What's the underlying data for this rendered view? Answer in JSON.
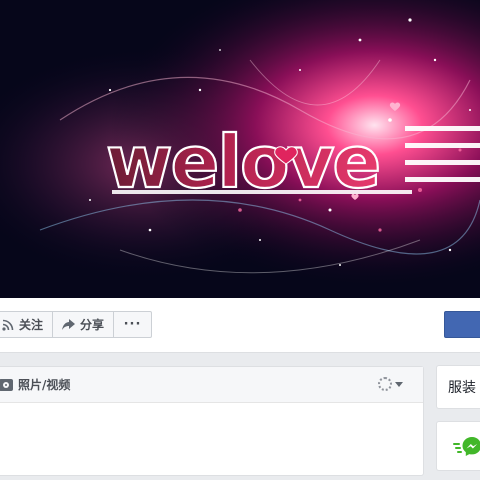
{
  "cover": {
    "logo_text": "welove",
    "accent_color": "#e0245e",
    "background_color": "#06061a"
  },
  "actions": {
    "follow_label": "关注",
    "share_label": "分享",
    "more_label": "···",
    "primary_color": "#4267b2"
  },
  "composer": {
    "photo_video_label": "照片/视频"
  },
  "sidebar": {
    "category_label": "服装"
  },
  "icons": {
    "follow": "rss-icon",
    "share": "share-arrow-icon",
    "photo": "camera-icon",
    "messenger": "messenger-icon",
    "audience": "audience-selector-icon"
  }
}
